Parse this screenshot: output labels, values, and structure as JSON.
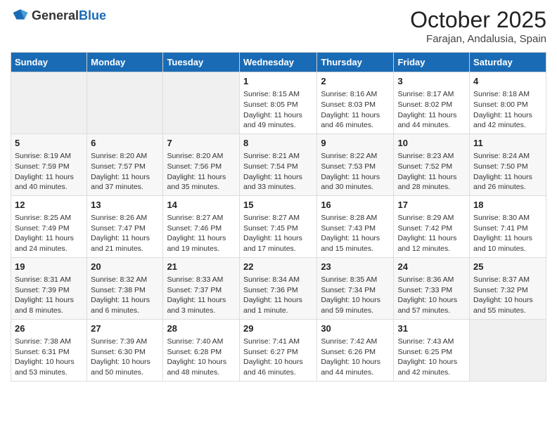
{
  "header": {
    "logo_general": "General",
    "logo_blue": "Blue",
    "month": "October 2025",
    "location": "Farajan, Andalusia, Spain"
  },
  "days_of_week": [
    "Sunday",
    "Monday",
    "Tuesday",
    "Wednesday",
    "Thursday",
    "Friday",
    "Saturday"
  ],
  "weeks": [
    [
      {
        "day": "",
        "info": ""
      },
      {
        "day": "",
        "info": ""
      },
      {
        "day": "",
        "info": ""
      },
      {
        "day": "1",
        "info": "Sunrise: 8:15 AM\nSunset: 8:05 PM\nDaylight: 11 hours and 49 minutes."
      },
      {
        "day": "2",
        "info": "Sunrise: 8:16 AM\nSunset: 8:03 PM\nDaylight: 11 hours and 46 minutes."
      },
      {
        "day": "3",
        "info": "Sunrise: 8:17 AM\nSunset: 8:02 PM\nDaylight: 11 hours and 44 minutes."
      },
      {
        "day": "4",
        "info": "Sunrise: 8:18 AM\nSunset: 8:00 PM\nDaylight: 11 hours and 42 minutes."
      }
    ],
    [
      {
        "day": "5",
        "info": "Sunrise: 8:19 AM\nSunset: 7:59 PM\nDaylight: 11 hours and 40 minutes."
      },
      {
        "day": "6",
        "info": "Sunrise: 8:20 AM\nSunset: 7:57 PM\nDaylight: 11 hours and 37 minutes."
      },
      {
        "day": "7",
        "info": "Sunrise: 8:20 AM\nSunset: 7:56 PM\nDaylight: 11 hours and 35 minutes."
      },
      {
        "day": "8",
        "info": "Sunrise: 8:21 AM\nSunset: 7:54 PM\nDaylight: 11 hours and 33 minutes."
      },
      {
        "day": "9",
        "info": "Sunrise: 8:22 AM\nSunset: 7:53 PM\nDaylight: 11 hours and 30 minutes."
      },
      {
        "day": "10",
        "info": "Sunrise: 8:23 AM\nSunset: 7:52 PM\nDaylight: 11 hours and 28 minutes."
      },
      {
        "day": "11",
        "info": "Sunrise: 8:24 AM\nSunset: 7:50 PM\nDaylight: 11 hours and 26 minutes."
      }
    ],
    [
      {
        "day": "12",
        "info": "Sunrise: 8:25 AM\nSunset: 7:49 PM\nDaylight: 11 hours and 24 minutes."
      },
      {
        "day": "13",
        "info": "Sunrise: 8:26 AM\nSunset: 7:47 PM\nDaylight: 11 hours and 21 minutes."
      },
      {
        "day": "14",
        "info": "Sunrise: 8:27 AM\nSunset: 7:46 PM\nDaylight: 11 hours and 19 minutes."
      },
      {
        "day": "15",
        "info": "Sunrise: 8:27 AM\nSunset: 7:45 PM\nDaylight: 11 hours and 17 minutes."
      },
      {
        "day": "16",
        "info": "Sunrise: 8:28 AM\nSunset: 7:43 PM\nDaylight: 11 hours and 15 minutes."
      },
      {
        "day": "17",
        "info": "Sunrise: 8:29 AM\nSunset: 7:42 PM\nDaylight: 11 hours and 12 minutes."
      },
      {
        "day": "18",
        "info": "Sunrise: 8:30 AM\nSunset: 7:41 PM\nDaylight: 11 hours and 10 minutes."
      }
    ],
    [
      {
        "day": "19",
        "info": "Sunrise: 8:31 AM\nSunset: 7:39 PM\nDaylight: 11 hours and 8 minutes."
      },
      {
        "day": "20",
        "info": "Sunrise: 8:32 AM\nSunset: 7:38 PM\nDaylight: 11 hours and 6 minutes."
      },
      {
        "day": "21",
        "info": "Sunrise: 8:33 AM\nSunset: 7:37 PM\nDaylight: 11 hours and 3 minutes."
      },
      {
        "day": "22",
        "info": "Sunrise: 8:34 AM\nSunset: 7:36 PM\nDaylight: 11 hours and 1 minute."
      },
      {
        "day": "23",
        "info": "Sunrise: 8:35 AM\nSunset: 7:34 PM\nDaylight: 10 hours and 59 minutes."
      },
      {
        "day": "24",
        "info": "Sunrise: 8:36 AM\nSunset: 7:33 PM\nDaylight: 10 hours and 57 minutes."
      },
      {
        "day": "25",
        "info": "Sunrise: 8:37 AM\nSunset: 7:32 PM\nDaylight: 10 hours and 55 minutes."
      }
    ],
    [
      {
        "day": "26",
        "info": "Sunrise: 7:38 AM\nSunset: 6:31 PM\nDaylight: 10 hours and 53 minutes."
      },
      {
        "day": "27",
        "info": "Sunrise: 7:39 AM\nSunset: 6:30 PM\nDaylight: 10 hours and 50 minutes."
      },
      {
        "day": "28",
        "info": "Sunrise: 7:40 AM\nSunset: 6:28 PM\nDaylight: 10 hours and 48 minutes."
      },
      {
        "day": "29",
        "info": "Sunrise: 7:41 AM\nSunset: 6:27 PM\nDaylight: 10 hours and 46 minutes."
      },
      {
        "day": "30",
        "info": "Sunrise: 7:42 AM\nSunset: 6:26 PM\nDaylight: 10 hours and 44 minutes."
      },
      {
        "day": "31",
        "info": "Sunrise: 7:43 AM\nSunset: 6:25 PM\nDaylight: 10 hours and 42 minutes."
      },
      {
        "day": "",
        "info": ""
      }
    ]
  ]
}
